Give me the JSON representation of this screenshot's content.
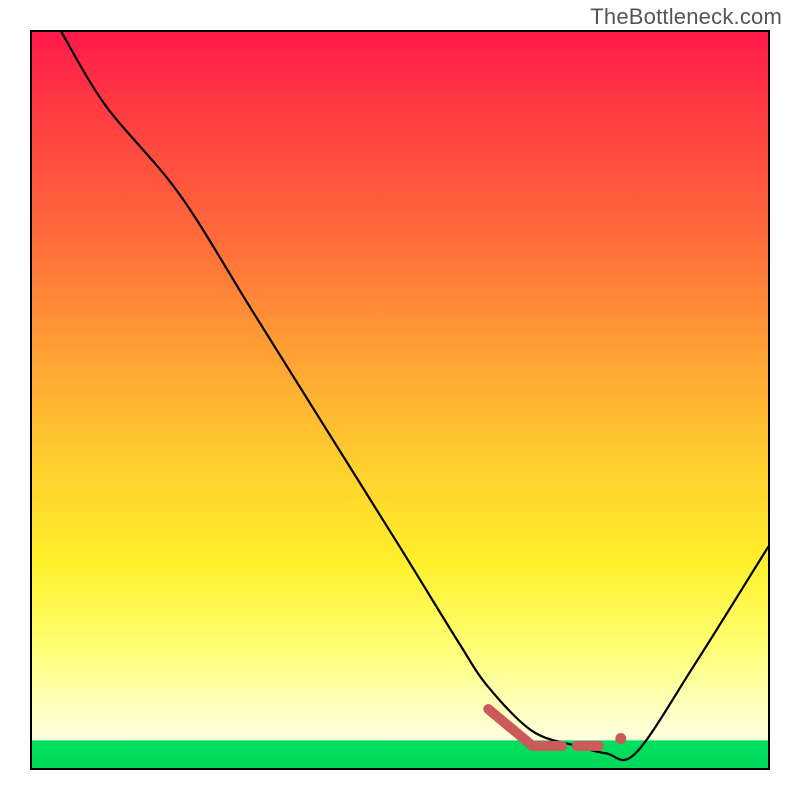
{
  "watermark": "TheBottleneck.com",
  "chart_data": {
    "type": "line",
    "title": "",
    "xlabel": "",
    "ylabel": "",
    "xlim": [
      0,
      100
    ],
    "ylim": [
      0,
      100
    ],
    "grid": false,
    "background_gradient": {
      "stops": [
        {
          "pos": 0,
          "color": "#ff1a4b"
        },
        {
          "pos": 0.45,
          "color": "#ffa534"
        },
        {
          "pos": 0.72,
          "color": "#fff02a"
        },
        {
          "pos": 0.92,
          "color": "#ffffc0"
        },
        {
          "pos": 0.963,
          "color": "#00e060"
        },
        {
          "pos": 1.0,
          "color": "#00d858"
        }
      ]
    },
    "series": [
      {
        "name": "bottleneck-curve",
        "x": [
          4,
          10,
          20,
          30,
          40,
          50,
          58,
          62,
          68,
          74,
          78,
          82,
          90,
          100
        ],
        "y": [
          100,
          90,
          78,
          62,
          46,
          30,
          17,
          11,
          5,
          3,
          2,
          2,
          14,
          30
        ],
        "stroke": "#000000"
      }
    ],
    "highlight": {
      "name": "optimal-range",
      "color": "#cc5a5a",
      "segments": [
        {
          "x": [
            62,
            68,
            72
          ],
          "y": [
            8,
            3,
            3
          ]
        },
        {
          "x": [
            74,
            77
          ],
          "y": [
            3,
            3
          ]
        }
      ],
      "points": [
        {
          "x": 80,
          "y": 4
        }
      ]
    }
  }
}
